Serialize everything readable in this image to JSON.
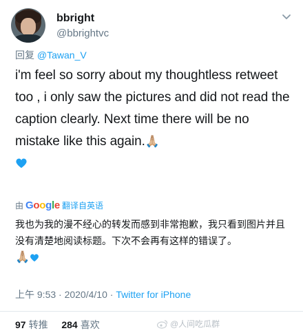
{
  "user": {
    "display_name": "bbright",
    "handle": "@bbrightvc"
  },
  "reply": {
    "prefix": "回复",
    "mention": "@Tawan_V"
  },
  "tweet": {
    "text": "i'm feel so sorry about my thoughtless retweet too , i only saw the pictures and did not read the caption clearly. Next time there will be no mistake like this again."
  },
  "translation": {
    "by": "由",
    "provider": "Google",
    "link": "翻译自英语",
    "text": "我也为我的漫不经心的转发而感到非常抱歉，我只看到图片并且没有清楚地阅读标题。下次不会再有这样的错误了。"
  },
  "meta": {
    "time_date": "上午 9:53 · 2020/4/10 · ",
    "source": "Twitter for iPhone"
  },
  "stats": {
    "retweets": "97",
    "retweets_label": "转推",
    "likes": "284",
    "likes_label": "喜欢"
  },
  "watermark": {
    "text": "@人间吃瓜群"
  },
  "icons": {
    "heart_color": "#1da1f2",
    "accent": "#1da1f2",
    "hands": "🙏🏼"
  }
}
